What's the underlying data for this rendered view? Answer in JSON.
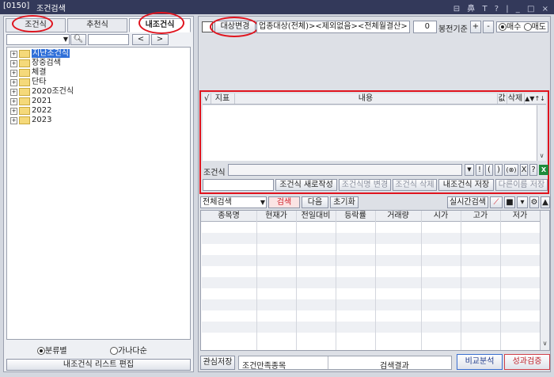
{
  "window": {
    "number": "[0150]",
    "title": "조건검색",
    "controls": "⊟ 鼻 T ? | _ □ ×"
  },
  "left": {
    "tabs": [
      {
        "label": "조건식",
        "active": false
      },
      {
        "label": "추천식",
        "active": false
      },
      {
        "label": "내조건식",
        "active": true
      }
    ],
    "nav_prev": "<",
    "nav_next": ">",
    "tree": [
      {
        "label": "지난조건식",
        "selected": true
      },
      {
        "label": "장중검색",
        "selected": false
      },
      {
        "label": "체결",
        "selected": false
      },
      {
        "label": "단타",
        "selected": false
      },
      {
        "label": "2020조건식",
        "selected": false
      },
      {
        "label": "2021",
        "selected": false
      },
      {
        "label": "2022",
        "selected": false
      },
      {
        "label": "2023",
        "selected": false
      }
    ],
    "radio_options": [
      {
        "label": "분류별",
        "checked": true
      },
      {
        "label": "가나다순",
        "checked": false
      }
    ],
    "edit_button": "내조건식 리스트 편집"
  },
  "right": {
    "target_change_button": "대상변경",
    "target_text": "업종대상(전체)><제외없음><전체월결산>",
    "stepper_value": "0",
    "bong_label": "봉전기준",
    "plus": "+",
    "minus": "-",
    "buy_label": "매수",
    "sell_label": "매도",
    "cond_table": {
      "check_col": "√",
      "indicator_col": "지표",
      "content_col": "내용",
      "value_col": "값",
      "delete_col": "삭제",
      "sort_arrows": "▲▼↑↓"
    },
    "cond_label": "조건식",
    "operators": [
      "▼",
      "!",
      "(",
      ")",
      "(⊗)",
      "X",
      "?"
    ],
    "action_buttons": [
      "조건식 새로작성",
      "조건식명 변경",
      "조건식 삭제",
      "내조건식 저장",
      "다른이름 저장"
    ],
    "search_scope": "전체검색",
    "search_button": "검색",
    "next_button": "다음",
    "reset_button": "초기화",
    "realtime_button": "실시간검색",
    "result_columns": [
      "종목명",
      "현재가",
      "전일대비",
      "등락률",
      "거래량",
      "시가",
      "고가",
      "저가"
    ],
    "bottom": {
      "watch_save": "관심저장",
      "satisfied_label": "조건만족종목",
      "result_label": "검색결과",
      "compare_button": "비교분석",
      "performance_button": "성과검증"
    }
  },
  "colors": {
    "title_bg": "#33395a",
    "highlight_red": "#e0141e",
    "selected_blue": "#2f6fd8",
    "search_btn_text": "#d0202a"
  }
}
